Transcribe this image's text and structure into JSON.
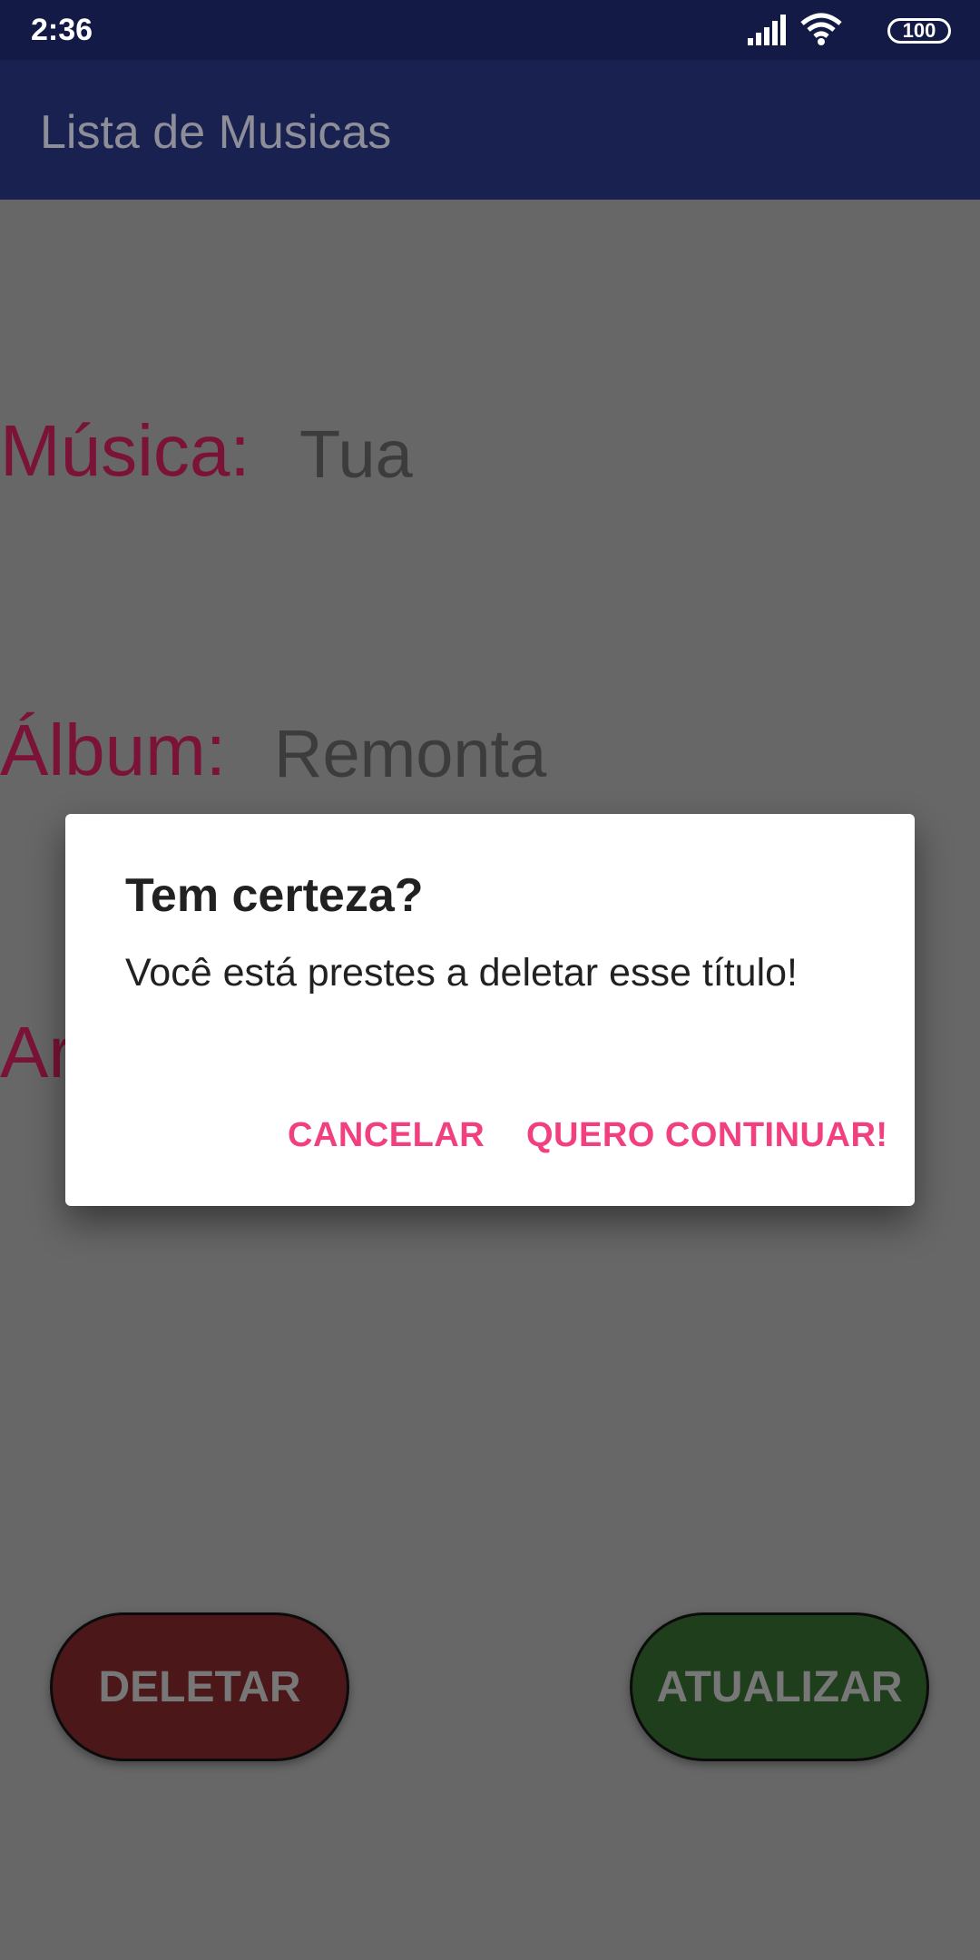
{
  "status_bar": {
    "time": "2:36",
    "battery": "100",
    "icons": [
      "signal-icon",
      "wifi-icon",
      "battery-icon"
    ]
  },
  "app_bar": {
    "title": "Lista de Musicas"
  },
  "fields": {
    "musica_label": "Música:",
    "musica_value": "Tua",
    "album_label": "Álbum:",
    "album_value": "Remonta",
    "artista_label_partial": "Ar"
  },
  "buttons": {
    "delete": "DELETAR",
    "update": "ATUALIZAR"
  },
  "dialog": {
    "title": "Tem certeza?",
    "message": "Você está prestes a deletar esse título!",
    "cancel": "CANCELAR",
    "confirm": "QUERO CONTINUAR!"
  },
  "colors": {
    "status_bar": "#131a45",
    "app_bar": "#192150",
    "label": "#7b1238",
    "dialog_action": "#f23f80",
    "delete_button": "#4b1719",
    "update_button": "#1f3f1c",
    "scrim_background": "#676767"
  }
}
